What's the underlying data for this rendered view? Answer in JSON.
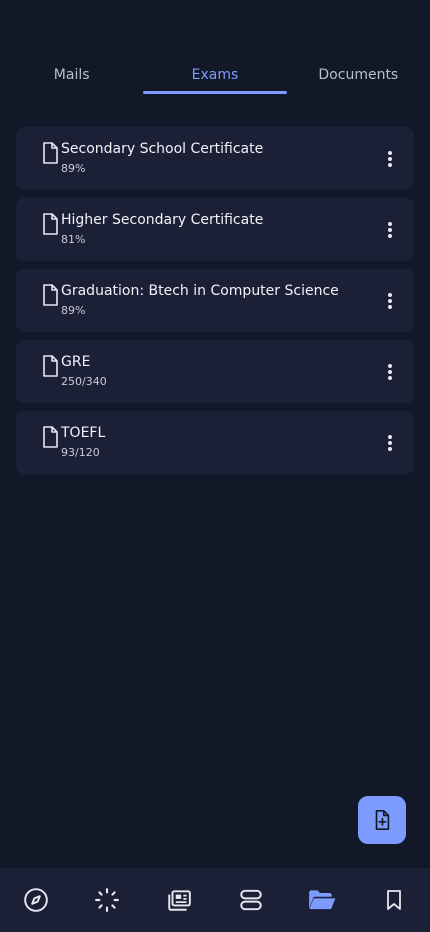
{
  "tabs": [
    {
      "label": "Mails",
      "active": false
    },
    {
      "label": "Exams",
      "active": true
    },
    {
      "label": "Documents",
      "active": false
    }
  ],
  "exams": [
    {
      "title": "Secondary School Certificate",
      "score": "89%"
    },
    {
      "title": "Higher Secondary Certificate",
      "score": "81%"
    },
    {
      "title": "Graduation: Btech in Computer Science",
      "score": "89%"
    },
    {
      "title": "GRE",
      "score": "250/340"
    },
    {
      "title": "TOEFL",
      "score": "93/120"
    }
  ],
  "fab": {
    "icon": "add-document-icon"
  },
  "bottom_nav": [
    {
      "icon": "compass-icon",
      "active": false
    },
    {
      "icon": "spinner-icon",
      "active": false
    },
    {
      "icon": "news-icon",
      "active": false
    },
    {
      "icon": "layers-icon",
      "active": false
    },
    {
      "icon": "folder-open-icon",
      "active": true
    },
    {
      "icon": "bookmark-icon",
      "active": false
    }
  ],
  "colors": {
    "accent": "#7d9bff",
    "background": "#121828",
    "card": "#1b2036"
  }
}
